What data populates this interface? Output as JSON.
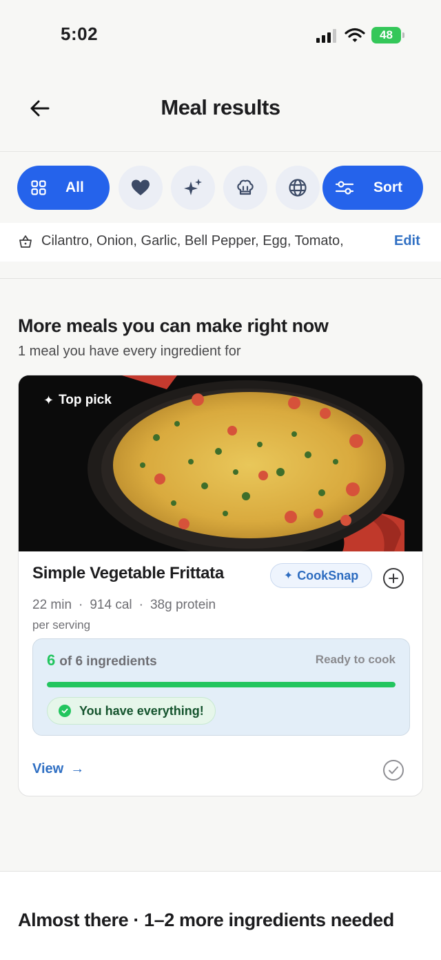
{
  "status_bar": {
    "time": "5:02",
    "battery": "48"
  },
  "header": {
    "title": "Meal results",
    "back_icon": "arrow-left-icon"
  },
  "filters": {
    "all_label": "All",
    "sort_label": "Sort",
    "icons": [
      "grid-icon",
      "heart-icon",
      "sparkle-icon",
      "chef-hat-icon",
      "globe-icon",
      "sliders-icon"
    ]
  },
  "ingredients_bar": {
    "text": "Cilantro, Onion, Garlic, Bell Pepper, Egg, Tomato,",
    "edit_label": "Edit"
  },
  "section": {
    "title": "More meals you can make right now",
    "subtitle": "1 meal you have every ingredient for"
  },
  "card": {
    "badge": "Top pick",
    "name": "Simple Vegetable Frittata",
    "cooksnap_label": "CookSnap",
    "time": "22 min",
    "calories": "914 cal",
    "protein": "38g protein",
    "per_serving": "per serving",
    "ingredients_have": "6",
    "ingredients_total_text": "of 6 ingredients",
    "ready_label": "Ready to cook",
    "progress": 1.0,
    "everything_label": "You have everything!",
    "view_label": "View",
    "colors": {
      "accent": "#2563eb",
      "success": "#22c55e",
      "link": "#2f6fc3"
    }
  },
  "section2": {
    "title": "Almost there · 1–2 more ingredients needed"
  }
}
